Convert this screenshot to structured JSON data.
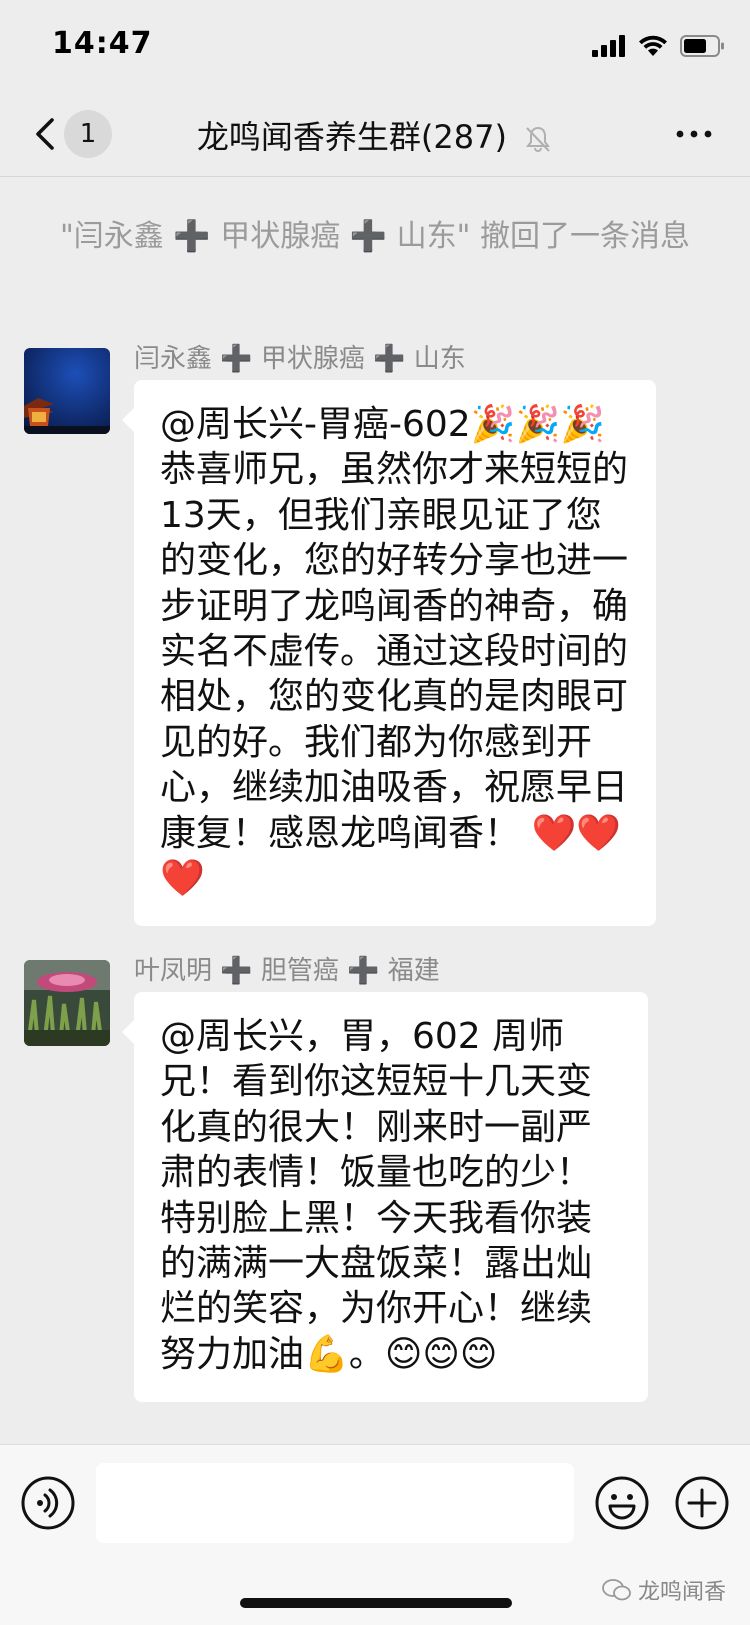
{
  "status_bar": {
    "time": "14:47"
  },
  "header": {
    "unread_count": "1",
    "title": "龙鸣闻香养生群(287)"
  },
  "system_notice": "\"闫永鑫 ➕ 甲状腺癌 ➕ 山东\" 撤回了一条消息",
  "messages": [
    {
      "sender": "闫永鑫 ➕ 甲状腺癌 ➕ 山东",
      "text": "@周长兴-胃癌-602🎉🎉🎉 恭喜师兄，虽然你才来短短的13天，但我们亲眼见证了您的变化，您的好转分享也进一步证明了龙鸣闻香的神奇，确实名不虚传。通过这段时间的相处，您的变化真的是肉眼可见的好。我们都为你感到开心，继续加油吸香，祝愿早日康复！感恩龙鸣闻香！ ❤️❤️❤️"
    },
    {
      "sender": "叶凤明 ➕ 胆管癌 ➕ 福建",
      "text": "@周长兴，胃，602 周师兄！看到你这短短十几天变化真的很大！刚来时一副严肃的表情！饭量也吃的少！特别脸上黑！今天我看你装的满满一大盘饭菜！露出灿烂的笑容，为你开心！继续努力加油💪。😊😊😊"
    }
  ],
  "input_bar": {
    "placeholder": ""
  },
  "watermark": "龙鸣闻香",
  "colors": {
    "background": "#ededed",
    "bubble": "#ffffff",
    "notice_text": "#9b9b9b",
    "sender_text": "#8a8a8a"
  }
}
